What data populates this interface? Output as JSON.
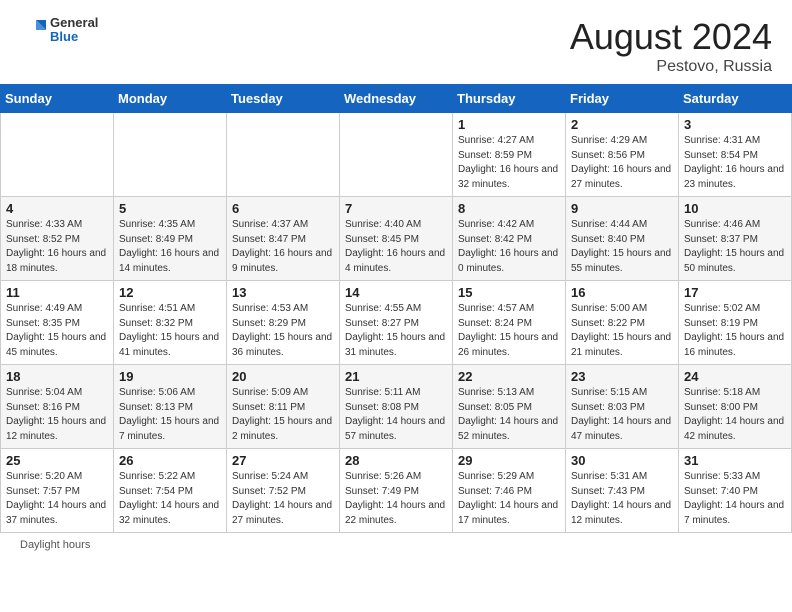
{
  "header": {
    "logo": {
      "general": "General",
      "blue": "Blue"
    },
    "month_year": "August 2024",
    "location": "Pestovo, Russia"
  },
  "days_of_week": [
    "Sunday",
    "Monday",
    "Tuesday",
    "Wednesday",
    "Thursday",
    "Friday",
    "Saturday"
  ],
  "weeks": [
    [
      {
        "day": "",
        "info": ""
      },
      {
        "day": "",
        "info": ""
      },
      {
        "day": "",
        "info": ""
      },
      {
        "day": "",
        "info": ""
      },
      {
        "day": "1",
        "info": "Sunrise: 4:27 AM\nSunset: 8:59 PM\nDaylight: 16 hours and 32 minutes."
      },
      {
        "day": "2",
        "info": "Sunrise: 4:29 AM\nSunset: 8:56 PM\nDaylight: 16 hours and 27 minutes."
      },
      {
        "day": "3",
        "info": "Sunrise: 4:31 AM\nSunset: 8:54 PM\nDaylight: 16 hours and 23 minutes."
      }
    ],
    [
      {
        "day": "4",
        "info": "Sunrise: 4:33 AM\nSunset: 8:52 PM\nDaylight: 16 hours and 18 minutes."
      },
      {
        "day": "5",
        "info": "Sunrise: 4:35 AM\nSunset: 8:49 PM\nDaylight: 16 hours and 14 minutes."
      },
      {
        "day": "6",
        "info": "Sunrise: 4:37 AM\nSunset: 8:47 PM\nDaylight: 16 hours and 9 minutes."
      },
      {
        "day": "7",
        "info": "Sunrise: 4:40 AM\nSunset: 8:45 PM\nDaylight: 16 hours and 4 minutes."
      },
      {
        "day": "8",
        "info": "Sunrise: 4:42 AM\nSunset: 8:42 PM\nDaylight: 16 hours and 0 minutes."
      },
      {
        "day": "9",
        "info": "Sunrise: 4:44 AM\nSunset: 8:40 PM\nDaylight: 15 hours and 55 minutes."
      },
      {
        "day": "10",
        "info": "Sunrise: 4:46 AM\nSunset: 8:37 PM\nDaylight: 15 hours and 50 minutes."
      }
    ],
    [
      {
        "day": "11",
        "info": "Sunrise: 4:49 AM\nSunset: 8:35 PM\nDaylight: 15 hours and 45 minutes."
      },
      {
        "day": "12",
        "info": "Sunrise: 4:51 AM\nSunset: 8:32 PM\nDaylight: 15 hours and 41 minutes."
      },
      {
        "day": "13",
        "info": "Sunrise: 4:53 AM\nSunset: 8:29 PM\nDaylight: 15 hours and 36 minutes."
      },
      {
        "day": "14",
        "info": "Sunrise: 4:55 AM\nSunset: 8:27 PM\nDaylight: 15 hours and 31 minutes."
      },
      {
        "day": "15",
        "info": "Sunrise: 4:57 AM\nSunset: 8:24 PM\nDaylight: 15 hours and 26 minutes."
      },
      {
        "day": "16",
        "info": "Sunrise: 5:00 AM\nSunset: 8:22 PM\nDaylight: 15 hours and 21 minutes."
      },
      {
        "day": "17",
        "info": "Sunrise: 5:02 AM\nSunset: 8:19 PM\nDaylight: 15 hours and 16 minutes."
      }
    ],
    [
      {
        "day": "18",
        "info": "Sunrise: 5:04 AM\nSunset: 8:16 PM\nDaylight: 15 hours and 12 minutes."
      },
      {
        "day": "19",
        "info": "Sunrise: 5:06 AM\nSunset: 8:13 PM\nDaylight: 15 hours and 7 minutes."
      },
      {
        "day": "20",
        "info": "Sunrise: 5:09 AM\nSunset: 8:11 PM\nDaylight: 15 hours and 2 minutes."
      },
      {
        "day": "21",
        "info": "Sunrise: 5:11 AM\nSunset: 8:08 PM\nDaylight: 14 hours and 57 minutes."
      },
      {
        "day": "22",
        "info": "Sunrise: 5:13 AM\nSunset: 8:05 PM\nDaylight: 14 hours and 52 minutes."
      },
      {
        "day": "23",
        "info": "Sunrise: 5:15 AM\nSunset: 8:03 PM\nDaylight: 14 hours and 47 minutes."
      },
      {
        "day": "24",
        "info": "Sunrise: 5:18 AM\nSunset: 8:00 PM\nDaylight: 14 hours and 42 minutes."
      }
    ],
    [
      {
        "day": "25",
        "info": "Sunrise: 5:20 AM\nSunset: 7:57 PM\nDaylight: 14 hours and 37 minutes."
      },
      {
        "day": "26",
        "info": "Sunrise: 5:22 AM\nSunset: 7:54 PM\nDaylight: 14 hours and 32 minutes."
      },
      {
        "day": "27",
        "info": "Sunrise: 5:24 AM\nSunset: 7:52 PM\nDaylight: 14 hours and 27 minutes."
      },
      {
        "day": "28",
        "info": "Sunrise: 5:26 AM\nSunset: 7:49 PM\nDaylight: 14 hours and 22 minutes."
      },
      {
        "day": "29",
        "info": "Sunrise: 5:29 AM\nSunset: 7:46 PM\nDaylight: 14 hours and 17 minutes."
      },
      {
        "day": "30",
        "info": "Sunrise: 5:31 AM\nSunset: 7:43 PM\nDaylight: 14 hours and 12 minutes."
      },
      {
        "day": "31",
        "info": "Sunrise: 5:33 AM\nSunset: 7:40 PM\nDaylight: 14 hours and 7 minutes."
      }
    ]
  ],
  "footer": {
    "daylight_hours_label": "Daylight hours"
  }
}
